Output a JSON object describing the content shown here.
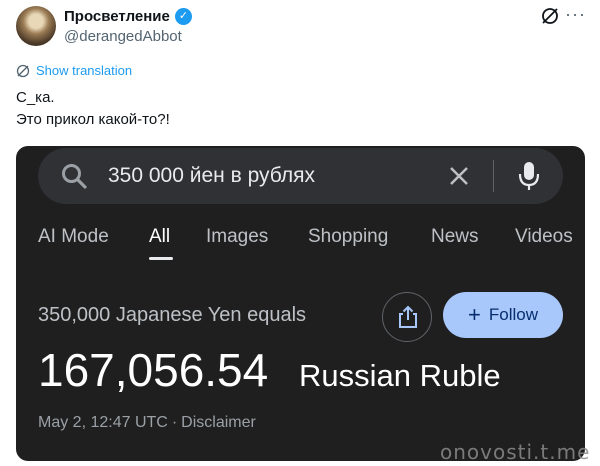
{
  "tweet": {
    "author_name": "Просветление",
    "handle": "@derangedAbbot",
    "translation_link": "Show translation",
    "text_line1": "С_ка.",
    "text_line2": "Это прикол какой-то?!"
  },
  "screenshot": {
    "search_query": "350 000 йен в рублях",
    "tabs": [
      "AI Mode",
      "All",
      "Images",
      "Shopping",
      "News",
      "Videos"
    ],
    "active_tab": "All",
    "equals_text": "350,000 Japanese Yen equals",
    "follow_label": "Follow",
    "result_value": "167,056.54",
    "result_unit": "Russian Ruble",
    "timestamp": "May 2, 12:47 UTC",
    "separator": "·",
    "disclaimer": "Disclaimer"
  },
  "watermark": "onovosti.t.me",
  "colors": {
    "verified_blue": "#1d9bf0",
    "dark_background": "#1f1f1f",
    "search_bar": "#303134",
    "follow_button": "#a8c7fa"
  }
}
